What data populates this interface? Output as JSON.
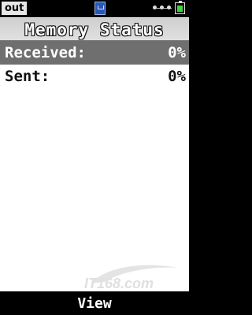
{
  "status_bar": {
    "mode_badge": "out",
    "icons": [
      "sd-card-icon",
      "volume-slider-icon",
      "battery-icon"
    ]
  },
  "header": {
    "title": "Memory Status"
  },
  "list": {
    "items": [
      {
        "label": "Received:",
        "value": "0%"
      },
      {
        "label": "Sent:",
        "value": "0%"
      }
    ],
    "selected_index": 0
  },
  "softkeys": {
    "center": "View"
  },
  "watermark": {
    "text": "IT168.com"
  },
  "colors": {
    "selected_row": "#6f6f6f",
    "title_bar": "#d6d6d6",
    "battery": "#3fd43f",
    "sd_icon": "#2a57b5"
  }
}
